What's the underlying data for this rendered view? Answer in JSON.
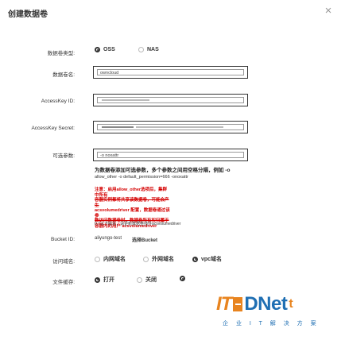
{
  "dialog": {
    "title": "创建数据卷",
    "close_label": "×"
  },
  "form": {
    "type": {
      "label": "数据卷类型:",
      "options": [
        "OSS",
        "NAS"
      ],
      "selected": "OSS"
    },
    "name": {
      "label": "数据卷名:",
      "value": "owncloud"
    },
    "access_key_id": {
      "label": "AccessKey ID:"
    },
    "access_key_secret": {
      "label": "AccessKey Secret:"
    },
    "optional_params": {
      "label": "可选参数:",
      "value": "-o noxattr",
      "help_lines": [
        "为数据卷添加可选参数，多个参数之间用空格分隔，例如 -o",
        "allow_other -o default_permission=666 -onoxattr"
      ],
      "warning_lines": [
        "注意：启用allow_other选项后，集群中所有",
        "容器实例都将共享该数据卷，可能会产生",
        "acsvolumedriver 配置，数据卷通过该参",
        "数访问数据卷时，数据卷所有权归属于",
        "容器内的用户 acsvolumedriver"
      ],
      "footnote": "0.7以下版本，请更新数据卷插件acsvolumedriver"
    },
    "bucket": {
      "label": "Bucket ID:",
      "value": "aliyungo-test",
      "link": "选择Bucket"
    },
    "access_mode": {
      "label": "访问域名:",
      "options": [
        "内网域名",
        "外网域名",
        "vpc域名"
      ],
      "selected": "vpc域名"
    },
    "file_cache": {
      "label": "文件缓存:",
      "options": [
        "打开",
        "关闭"
      ],
      "selected": "打开"
    }
  },
  "watermark": {
    "part1": "IT",
    "part2": "DNet",
    "part3": "t",
    "subtitle": "企 业 I T 解 决 方 案"
  }
}
